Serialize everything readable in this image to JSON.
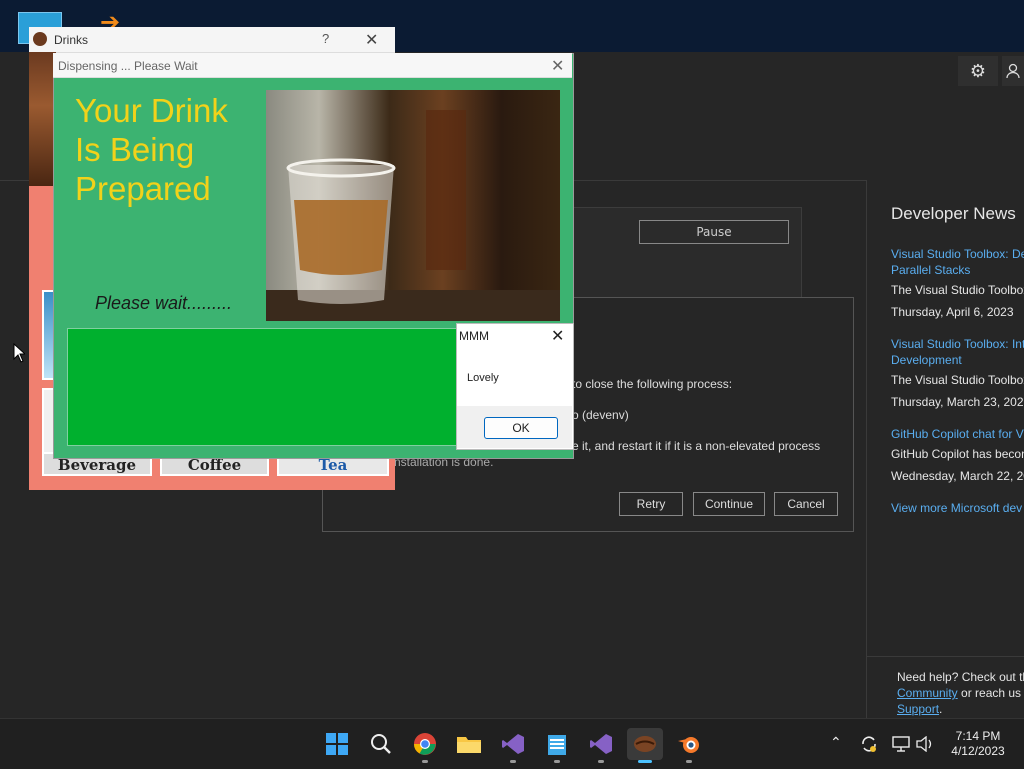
{
  "drinks_window": {
    "title": "Drinks",
    "help_glyph": "?",
    "close_glyph": "✕",
    "tiles": [
      {
        "label": "Beverage"
      },
      {
        "label": "Coffee"
      },
      {
        "label": "Tea"
      }
    ]
  },
  "dispensing_window": {
    "title": "Dispensing ... Please Wait",
    "close_glyph": "✕",
    "headline_lines": [
      "Your Drink",
      "Is Being",
      "Prepared"
    ],
    "wait_text": "Please wait........."
  },
  "message_box": {
    "title": "MMM",
    "close_glyph": "✕",
    "message": "Lovely",
    "ok_label": "OK"
  },
  "installer": {
    "pause_label": "Pause",
    "process_lines": [
      "to close the following process:",
      "o (devenv)",
      "e it, and restart it if it is a non-elevated process",
      "nstallation is done."
    ],
    "retry_label": "Retry",
    "continue_label": "Continue",
    "cancel_label": "Cancel",
    "settings_icon": "gear-icon",
    "account_icon": "person-icon"
  },
  "news": {
    "title": "Developer News",
    "items": [
      {
        "link_lines": [
          "Visual Studio Toolbox: De",
          "Parallel Stacks"
        ],
        "summary": "The Visual Studio Toolbox",
        "date": "Thursday, April 6, 2023"
      },
      {
        "link_lines": [
          "Visual Studio Toolbox: Int",
          "Development"
        ],
        "summary": "The Visual Studio Toolbox",
        "date": "Thursday, March 23, 2023"
      },
      {
        "link_lines": [
          "GitHub Copilot chat for V"
        ],
        "summary": "GitHub Copilot has becon",
        "date": "Wednesday, March 22, 20"
      }
    ],
    "more_link": "View more Microsoft dev"
  },
  "help": {
    "line1": "Need help? Check out th",
    "community_link": "Community",
    "line2_rest": " or reach us",
    "support_link": "Support",
    "period": "."
  },
  "taskbar": {
    "time": "7:14 PM",
    "date": "4/12/2023",
    "colors": {
      "accent": "#0078d4",
      "vs": "#8661c5"
    }
  }
}
